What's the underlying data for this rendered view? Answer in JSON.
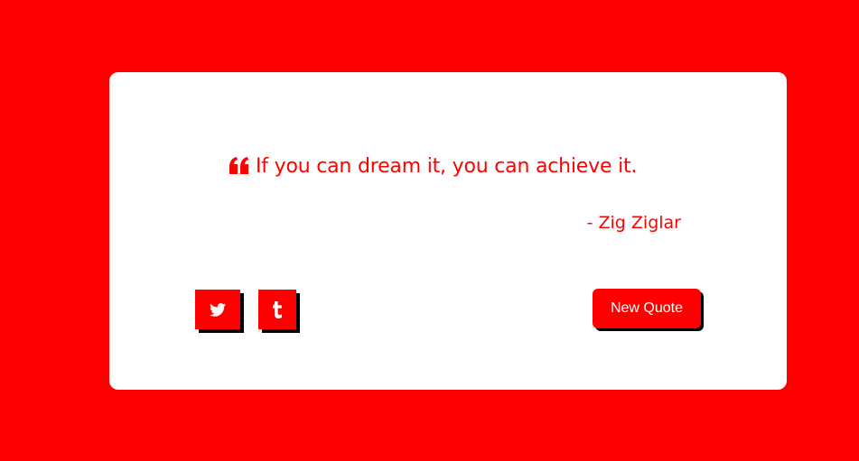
{
  "quote": {
    "text": "If you can dream it, you can achieve it.",
    "author": "- Zig Ziglar",
    "icon": "quote-left-icon"
  },
  "share": {
    "twitter_icon": "twitter-icon",
    "tumblr_icon": "tumblr-icon"
  },
  "actions": {
    "new_quote_label": "New Quote"
  },
  "colors": {
    "accent": "#ff0000",
    "card": "#ffffff",
    "shadow": "#000000"
  }
}
